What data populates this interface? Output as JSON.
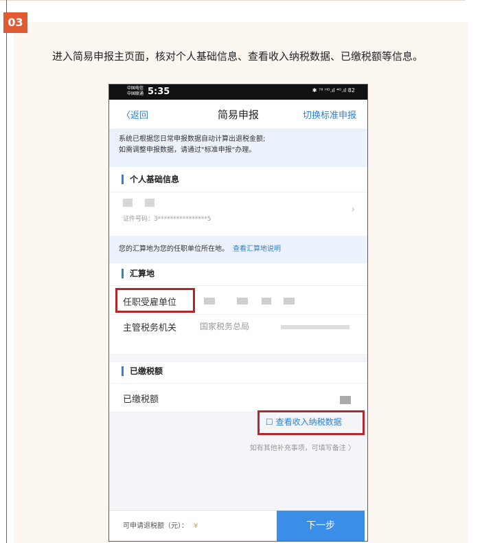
{
  "step_badge": "03",
  "intro_text": "进入简易申报主页面，核对个人基础信息、查看收入纳税数据、已缴税额等信息。",
  "phone": {
    "status_bar": {
      "carrier_line1": "中国电信",
      "carrier_line2": "中国联通",
      "time": "5:35",
      "right_icons": "✱ ⁷⁸ ᴴᴰ.ıl ⁴ᴳ.ıl 82"
    },
    "nav": {
      "back_label": "〈返回",
      "title": "简易申报",
      "switch_label": "切换标准申报"
    },
    "notice": {
      "line1": "系统已根据您日常申报数据自动计算出退税金额;",
      "line2": "如需调整申报数据，请通过\"标准申报\"办理。"
    },
    "personal_info": {
      "section_title": "个人基础信息",
      "id_label": "证件号码：3****************5",
      "chevron": "›"
    },
    "settlement_notice": {
      "text": "您的汇算地为您的任职单位所在地。",
      "link": "查看汇算地说明"
    },
    "settlement": {
      "section_title": "汇算地",
      "employer_label": "任职受雇单位",
      "tax_authority_label": "主管税务机关",
      "tax_authority_value": "国家税务总局"
    },
    "paid_tax": {
      "section_title": "已缴税额",
      "row_label": "已缴税额",
      "query_button": "查看收入纳税数据",
      "note": "如有其他补充事项，可填写备注 〉"
    },
    "bottom_bar": {
      "refund_label": "可申请退税额（元）：",
      "refund_currency": "¥",
      "next_button": "下一步"
    }
  },
  "colors": {
    "accent_blue": "#3b8ee8",
    "highlight_red": "#b5262a",
    "badge_orange": "#e05a34"
  }
}
